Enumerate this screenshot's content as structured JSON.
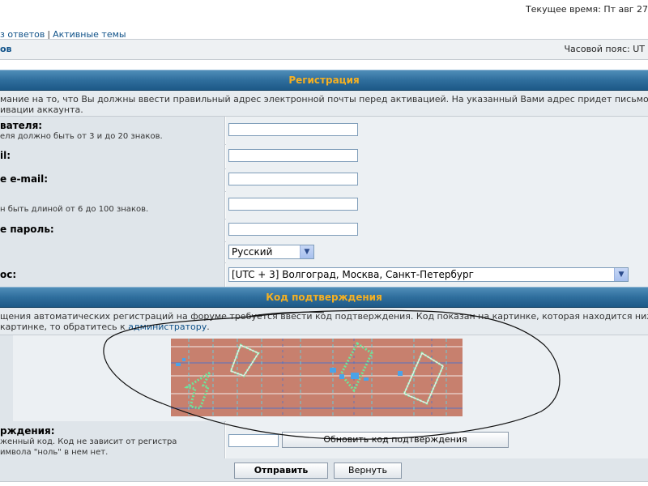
{
  "top": {
    "time": "Текущее время: Пт авг 27",
    "nav_link_1": "з ответов",
    "nav_sep": "|",
    "nav_link_2": "Активные темы"
  },
  "subbar": {
    "left": "ов",
    "timezone": "Часовой пояс: UT"
  },
  "registration": {
    "header": "Регистрация",
    "info_line_1": "мание на то, что Вы должны ввести правильный адрес электронной почты перед активацией. На указанный Вами адрес придет письмо, соде",
    "info_line_2": "ивации аккаунта.",
    "fields": [
      {
        "label": "вателя:",
        "explain": "еля должно быть от 3 и до 20 знаков."
      },
      {
        "label": "il:",
        "explain": ""
      },
      {
        "label": "e e-mail:",
        "explain": ""
      },
      {
        "label": "",
        "explain": "н быть длиной от 6 до 100 знаков."
      },
      {
        "label": "e пароль:",
        "explain": ""
      },
      {
        "label": "",
        "explain": ""
      },
      {
        "label": "ос:",
        "explain": ""
      }
    ],
    "language": {
      "value": "Русский"
    },
    "timezone_select": {
      "value": "[UTC + 3] Волгоград, Москва, Санкт-Петербург"
    }
  },
  "confirmation": {
    "header": "Код подтверждения",
    "info_line_1": "щения автоматических регистраций на форуме требуется ввести код подтверждения. Код показан на картинке, которая находится ниже. Е",
    "info_line_2_pre": "картинке, то обратитесь к ",
    "info_link": "администратору",
    "info_line_2_post": ".",
    "label": "рждения:",
    "explain_1": "женный код. Код не зависит от регистра",
    "explain_2": "имвола \"ноль\" в нем нет.",
    "refresh_button": "Обновить код подтверждения"
  },
  "buttons": {
    "submit": "Отправить",
    "back": "Вернуть"
  },
  "colors": {
    "header_text": "#f5b022",
    "header_bg": "#2f6e9d",
    "link": "#105289",
    "captcha_bg": "#c7806e",
    "captcha_glyph": "#5ee08a"
  }
}
